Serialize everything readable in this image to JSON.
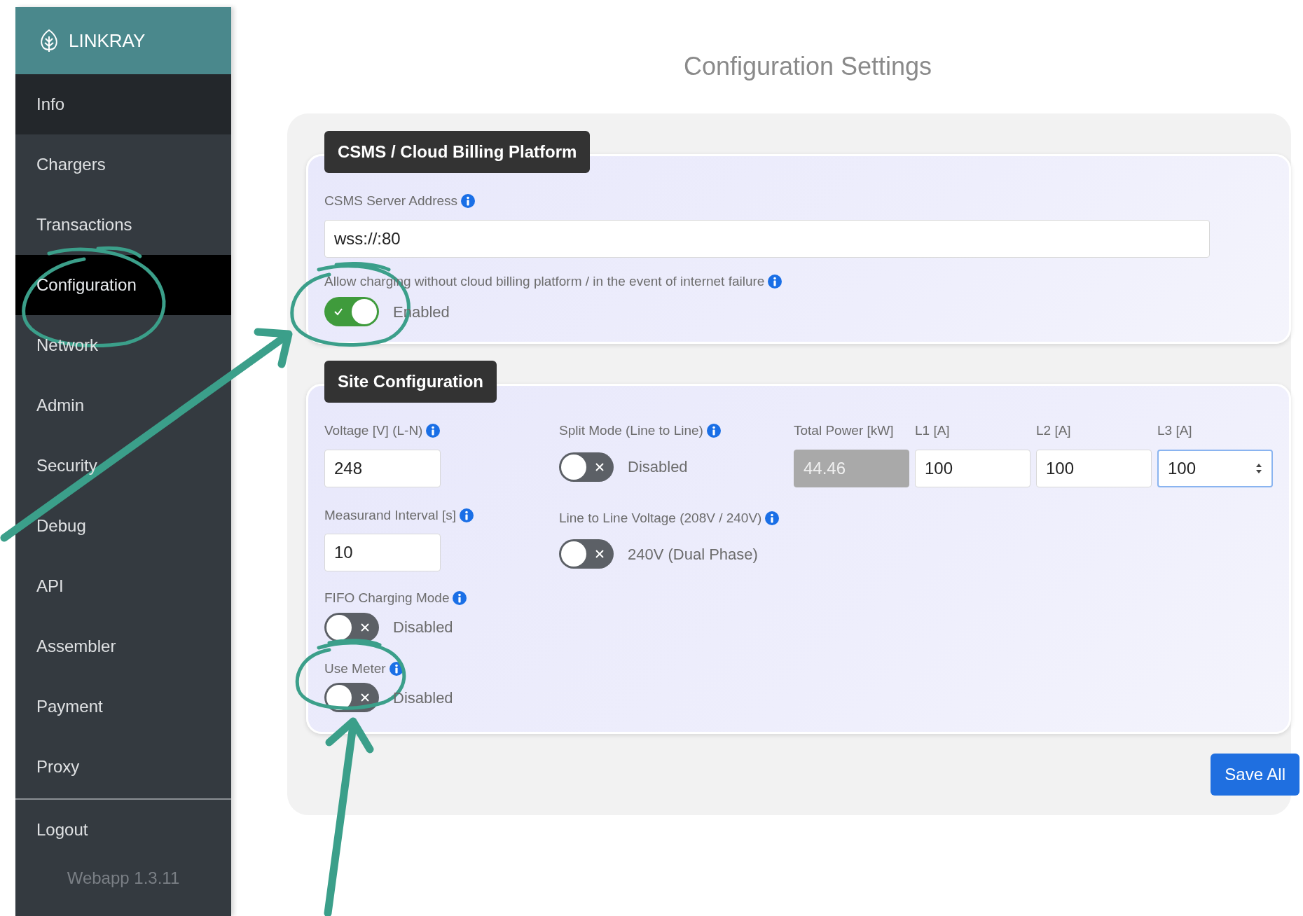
{
  "brand": "LINKRAY",
  "nav": [
    {
      "label": "Info",
      "selected": false,
      "hovered": true
    },
    {
      "label": "Chargers",
      "selected": false,
      "hovered": false
    },
    {
      "label": "Transactions",
      "selected": false,
      "hovered": false
    },
    {
      "label": "Configuration",
      "selected": true,
      "hovered": false
    },
    {
      "label": "Network",
      "selected": false,
      "hovered": false
    },
    {
      "label": "Admin",
      "selected": false,
      "hovered": false
    },
    {
      "label": "Security",
      "selected": false,
      "hovered": false
    },
    {
      "label": "Debug",
      "selected": false,
      "hovered": false
    },
    {
      "label": "API",
      "selected": false,
      "hovered": false
    },
    {
      "label": "Assembler",
      "selected": false,
      "hovered": false
    },
    {
      "label": "Payment",
      "selected": false,
      "hovered": false
    },
    {
      "label": "Proxy",
      "selected": false,
      "hovered": false
    }
  ],
  "logout": "Logout",
  "version": "Webapp 1.3.11",
  "page_title": "Configuration Settings",
  "csms": {
    "title": "CSMS / Cloud Billing Platform",
    "fields": [
      {
        "kind": "input",
        "label": "CSMS Server Address",
        "info": true,
        "value": "wss://:80"
      },
      {
        "kind": "toggle",
        "label": "Allow charging without cloud billing platform / in the event of internet failure",
        "info": true,
        "checked": true,
        "status": "Enabled"
      }
    ]
  },
  "site": {
    "title": "Site Configuration",
    "left": [
      {
        "kind": "input",
        "label": "Voltage [V] (L-N)",
        "info": true,
        "value": "248"
      },
      {
        "kind": "input",
        "label": "Measurand Interval [s]",
        "info": true,
        "value": "10"
      },
      {
        "kind": "toggle",
        "label": "FIFO Charging Mode",
        "info": true,
        "checked": false,
        "status": "Disabled"
      },
      {
        "kind": "toggle",
        "label": "Use Meter",
        "info": true,
        "checked": false,
        "status": "Disabled"
      }
    ],
    "middle": [
      {
        "kind": "toggle",
        "label": "Split Mode (Line to Line)",
        "info": true,
        "checked": false,
        "status": "Disabled"
      },
      {
        "kind": "toggle",
        "label": "Line to Line Voltage (208V / 240V)",
        "info": true,
        "checked": false,
        "status": "240V (Dual Phase)"
      }
    ],
    "power": [
      {
        "kind": "text",
        "label": "Total Power [kW]",
        "value": "44.46",
        "disabled": true,
        "focused": false
      },
      {
        "kind": "text",
        "label": "L1 [A]",
        "value": "100",
        "disabled": false,
        "focused": false
      },
      {
        "kind": "text",
        "label": "L2 [A]",
        "value": "100",
        "disabled": false,
        "focused": false
      },
      {
        "kind": "number",
        "label": "L3 [A]",
        "value": "100",
        "disabled": false,
        "focused": true
      }
    ]
  },
  "save_button": "Save All"
}
